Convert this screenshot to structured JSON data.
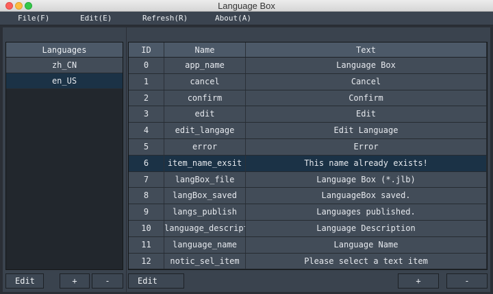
{
  "window": {
    "title": "Language Box"
  },
  "menu": [
    {
      "label": "File(F)"
    },
    {
      "label": "Edit(E)"
    },
    {
      "label": "Refresh(R)"
    },
    {
      "label": "About(A)"
    }
  ],
  "languages": {
    "header": "Languages",
    "items": [
      "zh_CN",
      "en_US"
    ],
    "selected": "en_US"
  },
  "table": {
    "columns": [
      "ID",
      "Name",
      "Text"
    ],
    "selected_id": "6",
    "rows": [
      {
        "id": "0",
        "name": "app_name",
        "text": "Language Box"
      },
      {
        "id": "1",
        "name": "cancel",
        "text": "Cancel"
      },
      {
        "id": "2",
        "name": "confirm",
        "text": "Confirm"
      },
      {
        "id": "3",
        "name": "edit",
        "text": "Edit"
      },
      {
        "id": "4",
        "name": "edit_langage",
        "text": "Edit Language"
      },
      {
        "id": "5",
        "name": "error",
        "text": "Error"
      },
      {
        "id": "6",
        "name": "item_name_exsit",
        "text": "This name already exists!"
      },
      {
        "id": "7",
        "name": "langBox_file",
        "text": "Language Box (*.jlb)"
      },
      {
        "id": "8",
        "name": "langBox_saved",
        "text": "LanguageBox saved."
      },
      {
        "id": "9",
        "name": "langs_publish",
        "text": "Languages published."
      },
      {
        "id": "10",
        "name": "language_descript",
        "text": "Language Description"
      },
      {
        "id": "11",
        "name": "language_name",
        "text": "Language Name"
      },
      {
        "id": "12",
        "name": "notic_sel_item",
        "text": "Please select a text item"
      }
    ]
  },
  "left_buttons": {
    "edit": "Edit",
    "add": "+",
    "remove": "-"
  },
  "right_buttons": {
    "edit": "Edit",
    "add": "+",
    "remove": "-"
  }
}
